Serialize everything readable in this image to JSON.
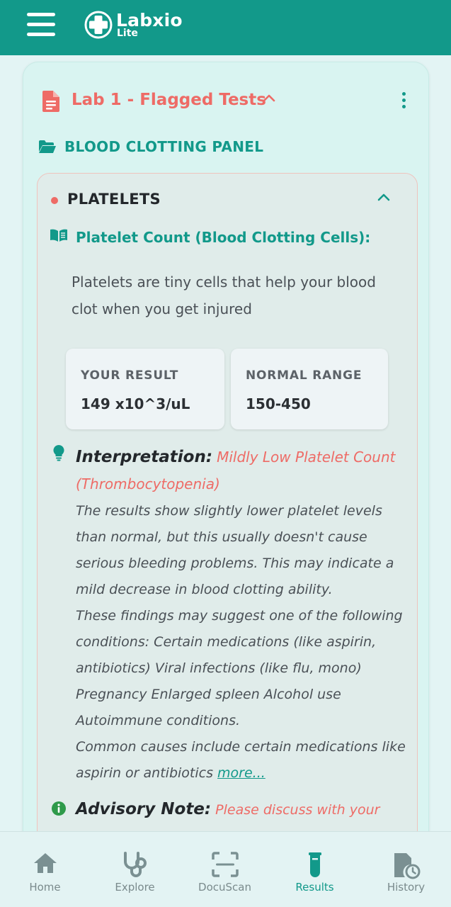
{
  "header": {
    "app_name": "Labxio",
    "app_sub": "Lite",
    "menu_icon": "hamburger-menu-icon",
    "color": "#12998a"
  },
  "report": {
    "title": "Lab 1 - Flagged Tests",
    "title_color": "#ee6b66",
    "panel": "BLOOD CLOTTING PANEL",
    "test": {
      "name": "PLATELETS",
      "status_color": "#ee6b66",
      "subtitle": "Platelet Count (Blood Clotting Cells):",
      "description": "Platelets are tiny cells that help your blood clot when you get injured",
      "result_label": "YOUR RESULT",
      "result_value": "149 x10^3/uL",
      "range_label": "NORMAL RANGE",
      "range_value": "150-450",
      "interpretation_label": "Interpretation:",
      "interpretation_value": "Mildly Low Platelet Count (Thrombocytopenia)",
      "interpretation_p1": "The results show slightly lower platelet levels than normal, but this usually doesn't cause serious bleeding problems. This may indicate a mild decrease in blood clotting ability.",
      "interpretation_p2": "These findings may suggest one of the following conditions: Certain medications (like aspirin, antibiotics) Viral infections (like flu, mono) Pregnancy Enlarged spleen Alcohol use Autoimmune conditions.",
      "interpretation_p3": "Common causes include certain medications like aspirin or antibiotics",
      "more_link": "more...",
      "advisory_label": "Advisory Note:",
      "advisory_value": "Please discuss with your"
    }
  },
  "nav": {
    "items": [
      {
        "label": "Home",
        "icon": "home-icon"
      },
      {
        "label": "Explore",
        "icon": "stethoscope-icon"
      },
      {
        "label": "DocuScan",
        "icon": "scan-icon"
      },
      {
        "label": "Results",
        "icon": "test-tube-icon",
        "active": true
      },
      {
        "label": "History",
        "icon": "history-icon"
      }
    ],
    "active_color": "#12998a",
    "inactive_color": "#7a8a8c"
  }
}
